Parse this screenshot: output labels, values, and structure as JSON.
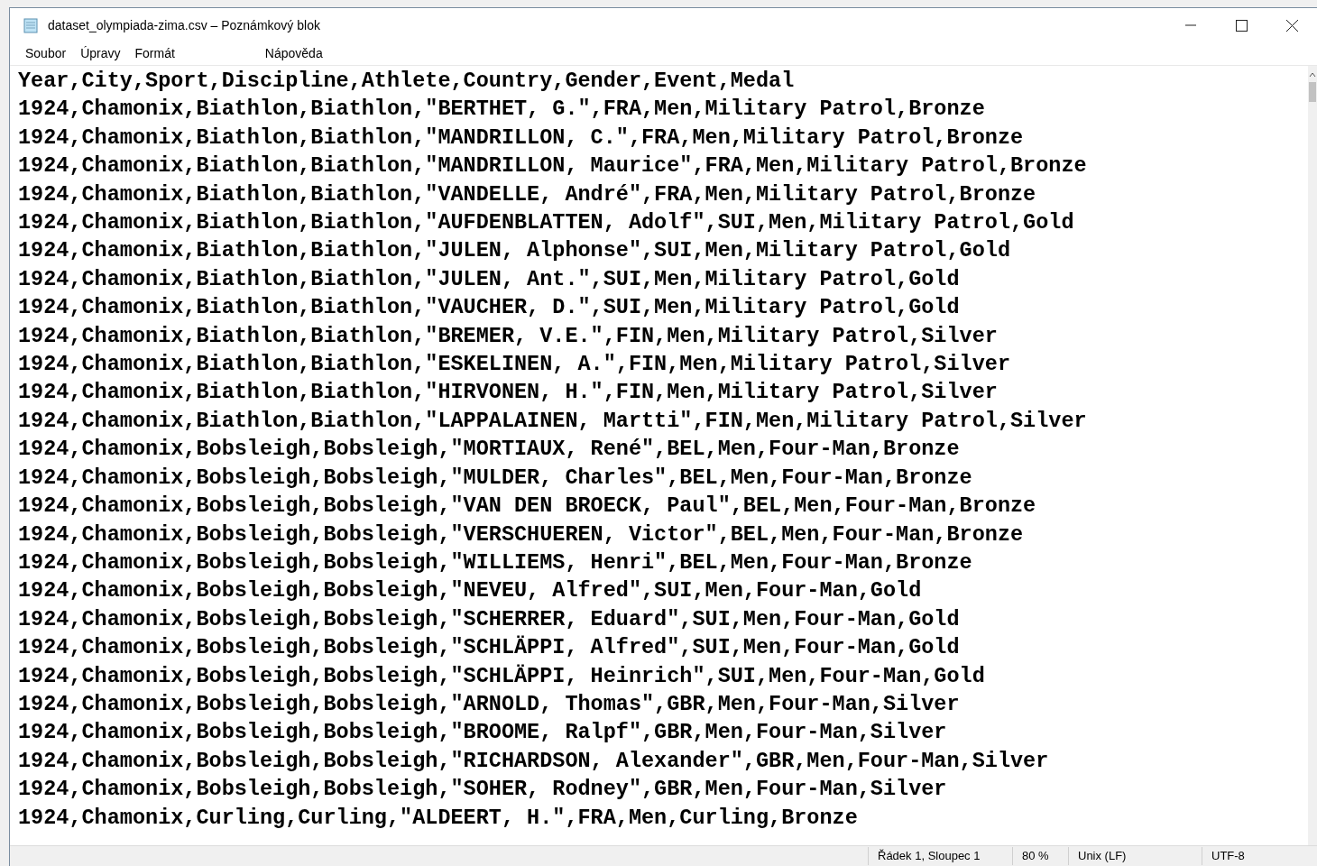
{
  "window": {
    "title": "dataset_olympiada-zima.csv – Poznámkový blok"
  },
  "menu": [
    "Soubor",
    "Úpravy",
    "Formát",
    "Nápověda"
  ],
  "lines": [
    "Year,City,Sport,Discipline,Athlete,Country,Gender,Event,Medal",
    "1924,Chamonix,Biathlon,Biathlon,\"BERTHET, G.\",FRA,Men,Military Patrol,Bronze",
    "1924,Chamonix,Biathlon,Biathlon,\"MANDRILLON, C.\",FRA,Men,Military Patrol,Bronze",
    "1924,Chamonix,Biathlon,Biathlon,\"MANDRILLON, Maurice\",FRA,Men,Military Patrol,Bronze",
    "1924,Chamonix,Biathlon,Biathlon,\"VANDELLE, André\",FRA,Men,Military Patrol,Bronze",
    "1924,Chamonix,Biathlon,Biathlon,\"AUFDENBLATTEN, Adolf\",SUI,Men,Military Patrol,Gold",
    "1924,Chamonix,Biathlon,Biathlon,\"JULEN, Alphonse\",SUI,Men,Military Patrol,Gold",
    "1924,Chamonix,Biathlon,Biathlon,\"JULEN, Ant.\",SUI,Men,Military Patrol,Gold",
    "1924,Chamonix,Biathlon,Biathlon,\"VAUCHER, D.\",SUI,Men,Military Patrol,Gold",
    "1924,Chamonix,Biathlon,Biathlon,\"BREMER, V.E.\",FIN,Men,Military Patrol,Silver",
    "1924,Chamonix,Biathlon,Biathlon,\"ESKELINEN, A.\",FIN,Men,Military Patrol,Silver",
    "1924,Chamonix,Biathlon,Biathlon,\"HIRVONEN, H.\",FIN,Men,Military Patrol,Silver",
    "1924,Chamonix,Biathlon,Biathlon,\"LAPPALAINEN, Martti\",FIN,Men,Military Patrol,Silver",
    "1924,Chamonix,Bobsleigh,Bobsleigh,\"MORTIAUX, René\",BEL,Men,Four-Man,Bronze",
    "1924,Chamonix,Bobsleigh,Bobsleigh,\"MULDER, Charles\",BEL,Men,Four-Man,Bronze",
    "1924,Chamonix,Bobsleigh,Bobsleigh,\"VAN DEN BROECK, Paul\",BEL,Men,Four-Man,Bronze",
    "1924,Chamonix,Bobsleigh,Bobsleigh,\"VERSCHUEREN, Victor\",BEL,Men,Four-Man,Bronze",
    "1924,Chamonix,Bobsleigh,Bobsleigh,\"WILLIEMS, Henri\",BEL,Men,Four-Man,Bronze",
    "1924,Chamonix,Bobsleigh,Bobsleigh,\"NEVEU, Alfred\",SUI,Men,Four-Man,Gold",
    "1924,Chamonix,Bobsleigh,Bobsleigh,\"SCHERRER, Eduard\",SUI,Men,Four-Man,Gold",
    "1924,Chamonix,Bobsleigh,Bobsleigh,\"SCHLÄPPI, Alfred\",SUI,Men,Four-Man,Gold",
    "1924,Chamonix,Bobsleigh,Bobsleigh,\"SCHLÄPPI, Heinrich\",SUI,Men,Four-Man,Gold",
    "1924,Chamonix,Bobsleigh,Bobsleigh,\"ARNOLD, Thomas\",GBR,Men,Four-Man,Silver",
    "1924,Chamonix,Bobsleigh,Bobsleigh,\"BROOME, Ralpf\",GBR,Men,Four-Man,Silver",
    "1924,Chamonix,Bobsleigh,Bobsleigh,\"RICHARDSON, Alexander\",GBR,Men,Four-Man,Silver",
    "1924,Chamonix,Bobsleigh,Bobsleigh,\"SOHER, Rodney\",GBR,Men,Four-Man,Silver",
    "1924,Chamonix,Curling,Curling,\"ALDEERT, H.\",FRA,Men,Curling,Bronze"
  ],
  "status_bar": {
    "position": "Řádek 1, Sloupec 1",
    "zoom": "80 %",
    "line_ending": "Unix (LF)",
    "encoding": "UTF-8"
  }
}
